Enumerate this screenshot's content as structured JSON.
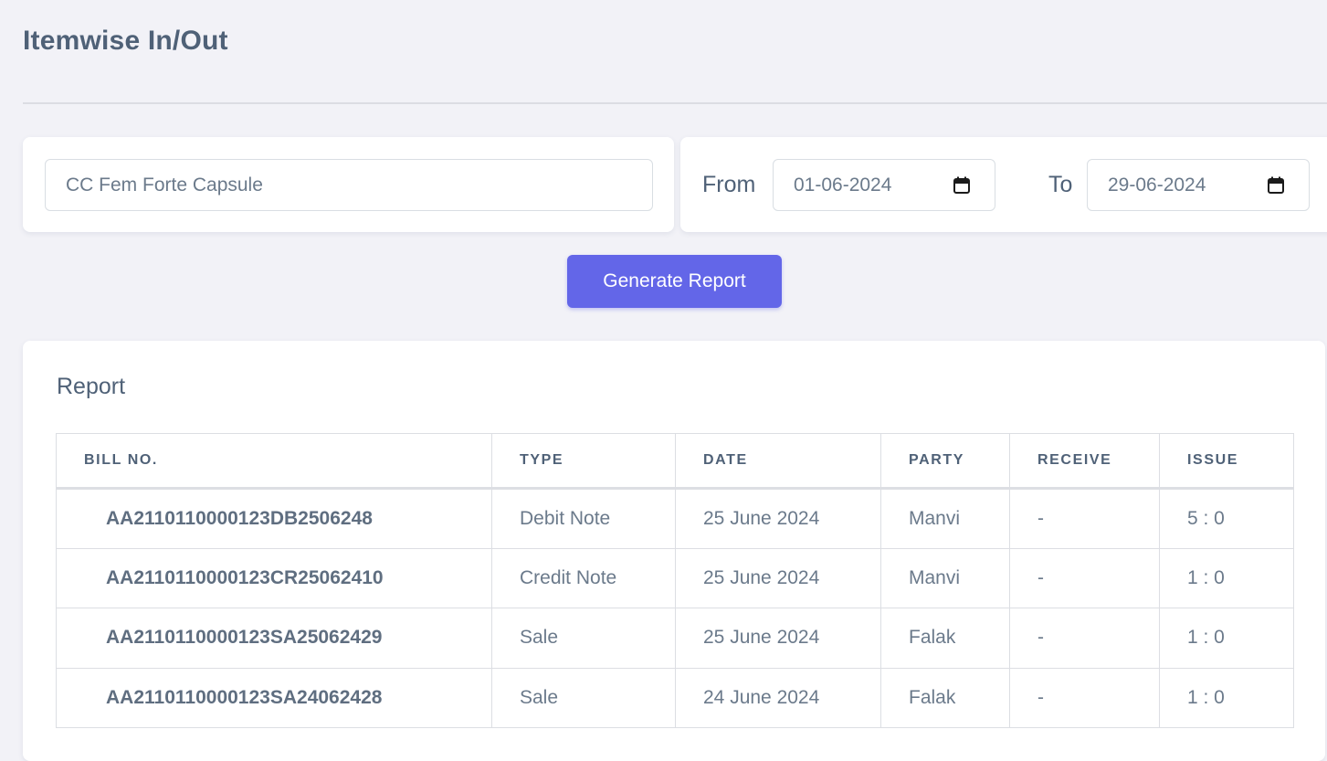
{
  "page": {
    "title": "Itemwise In/Out"
  },
  "filters": {
    "item_value": "CC Fem Forte Capsule",
    "from_label": "From",
    "from_value": "01-06-2024",
    "to_label": "To",
    "to_value": "29-06-2024",
    "calendar_icon": "calendar-icon"
  },
  "actions": {
    "generate_label": "Generate Report",
    "accent_color": "#6366e8"
  },
  "report": {
    "title": "Report",
    "columns": [
      "BILL NO.",
      "TYPE",
      "DATE",
      "PARTY",
      "RECEIVE",
      "ISSUE"
    ],
    "rows": [
      {
        "bill": "AA2110110000123DB2506248",
        "type": "Debit Note",
        "date": "25 June 2024",
        "party": "Manvi",
        "receive": "-",
        "issue": "5 : 0"
      },
      {
        "bill": "AA2110110000123CR25062410",
        "type": "Credit Note",
        "date": "25 June 2024",
        "party": "Manvi",
        "receive": "-",
        "issue": "1 : 0"
      },
      {
        "bill": "AA2110110000123SA25062429",
        "type": "Sale",
        "date": "25 June 2024",
        "party": "Falak",
        "receive": "-",
        "issue": "1 : 0"
      },
      {
        "bill": "AA2110110000123SA24062428",
        "type": "Sale",
        "date": "24 June 2024",
        "party": "Falak",
        "receive": "-",
        "issue": "1 : 0"
      }
    ]
  }
}
